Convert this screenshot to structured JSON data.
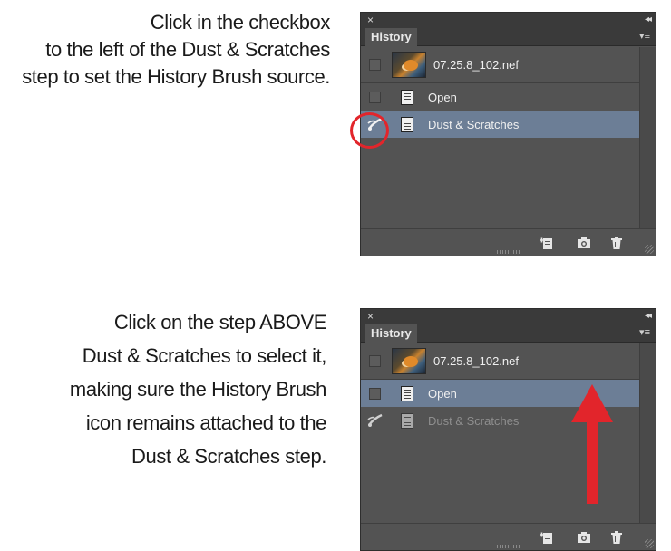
{
  "instructions": [
    {
      "lines": [
        "Click in the checkbox",
        "to the left of the Dust & Scratches",
        "step to set the History Brush source."
      ]
    },
    {
      "lines": [
        "Click on the step ABOVE",
        "Dust & Scratches to select it,",
        "making sure the History Brush",
        "icon remains attached to the",
        "Dust & Scratches step."
      ]
    }
  ],
  "panels": [
    {
      "close": "×",
      "collapse": "◂◂",
      "tab": "History",
      "menu": "▾≡",
      "snapshot": "07.25.8_102.nef",
      "steps": [
        "Open",
        "Dust & Scratches"
      ],
      "selected_step": "Dust & Scratches",
      "history_brush_source": "Dust & Scratches"
    },
    {
      "close": "×",
      "collapse": "◂◂",
      "tab": "History",
      "menu": "▾≡",
      "snapshot": "07.25.8_102.nef",
      "steps": [
        "Open",
        "Dust & Scratches"
      ],
      "selected_step": "Open",
      "history_brush_source": "Dust & Scratches"
    }
  ],
  "icons": {
    "new-document-from-state": "new-document-icon",
    "new-snapshot": "camera-icon",
    "delete-state": "trash-icon",
    "history-brush": "history-brush-icon"
  },
  "colors": {
    "panel_bg": "#535353",
    "selected_row": "#6c7e96",
    "annotation_red": "#e2252b"
  }
}
